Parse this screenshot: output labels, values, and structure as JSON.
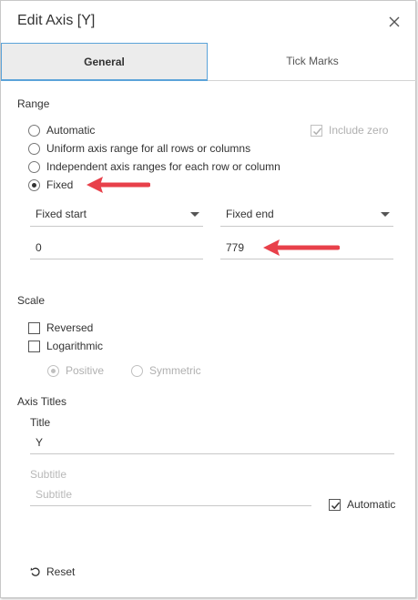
{
  "dialog": {
    "title": "Edit Axis [Y]"
  },
  "tabs": [
    {
      "label": "General",
      "active": true
    },
    {
      "label": "Tick Marks",
      "active": false
    }
  ],
  "range": {
    "section_title": "Range",
    "options": [
      {
        "label": "Automatic",
        "selected": false
      },
      {
        "label": "Uniform axis range for all rows or columns",
        "selected": false
      },
      {
        "label": "Independent axis ranges for each row or column",
        "selected": false
      },
      {
        "label": "Fixed",
        "selected": true
      }
    ],
    "include_zero": {
      "label": "Include zero",
      "checked": true,
      "disabled": true
    },
    "start_dropdown": {
      "selected": "Fixed start"
    },
    "end_dropdown": {
      "selected": "Fixed end"
    },
    "start_value": "0",
    "end_value": "779"
  },
  "scale": {
    "section_title": "Scale",
    "reversed": {
      "label": "Reversed",
      "checked": false
    },
    "logarithmic": {
      "label": "Logarithmic",
      "checked": false
    },
    "positive": {
      "label": "Positive",
      "selected": true,
      "disabled": true
    },
    "symmetric": {
      "label": "Symmetric",
      "selected": false,
      "disabled": true
    }
  },
  "axis_titles": {
    "section_title": "Axis Titles",
    "title_label": "Title",
    "title_value": "Y",
    "subtitle_label": "Subtitle",
    "subtitle_placeholder": "Subtitle",
    "automatic": {
      "label": "Automatic",
      "checked": true
    }
  },
  "footer": {
    "reset_label": "Reset"
  },
  "colors": {
    "accent": "#5ba3d9",
    "annotation_arrow": "#e8404a"
  }
}
